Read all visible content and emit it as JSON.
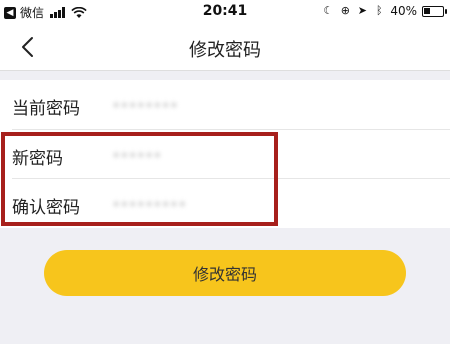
{
  "status_bar": {
    "carrier": "微信",
    "time": "20:41",
    "battery": "40%",
    "battery_level": 0.4,
    "icons": [
      "moon-icon",
      "orientation-lock-icon",
      "location-icon",
      "bluetooth-icon"
    ]
  },
  "nav": {
    "title": "修改密码",
    "back_icon": "chevron-left-icon"
  },
  "form": {
    "current_password_label": "当前密码",
    "current_password_value": "••••••••",
    "new_password_label": "新密码",
    "new_password_value": "••••••",
    "confirm_password_label": "确认密码",
    "confirm_password_value": "•••••••••"
  },
  "submit": {
    "label": "修改密码"
  },
  "colors": {
    "accent": "#f7c51c",
    "highlight": "#a7201c",
    "background": "#efeff4"
  }
}
